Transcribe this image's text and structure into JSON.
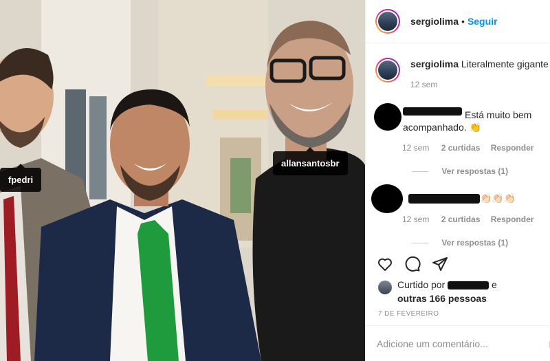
{
  "photo": {
    "tags": [
      "fpedri",
      "allansantosbr"
    ]
  },
  "header": {
    "username": "sergiolima",
    "separator": "•",
    "follow_label": "Seguir"
  },
  "caption": {
    "username": "sergiolima",
    "text": "Literalmente gigante",
    "time": "12 sem"
  },
  "comments": [
    {
      "text_line1": "Está muito bem",
      "text_line2": "acompanhado. 👏",
      "time": "12 sem",
      "likes": "2 curtidas",
      "reply_label": "Responder",
      "view_replies": "Ver respostas (1)"
    },
    {
      "text": "👏🏻👏🏻👏🏻",
      "time": "12 sem",
      "likes": "2 curtidas",
      "reply_label": "Responder",
      "view_replies": "Ver respostas (1)"
    }
  ],
  "actions": {
    "like_icon": "heart-icon",
    "comment_icon": "comment-icon",
    "share_icon": "share-icon"
  },
  "likes": {
    "prefix": "Curtido por",
    "suffix": "e",
    "others": "outras 166 pessoas"
  },
  "date": "7 DE FEVEREIRO",
  "add_comment": {
    "placeholder": "Adicione um comentário...",
    "publish_label": "P"
  }
}
